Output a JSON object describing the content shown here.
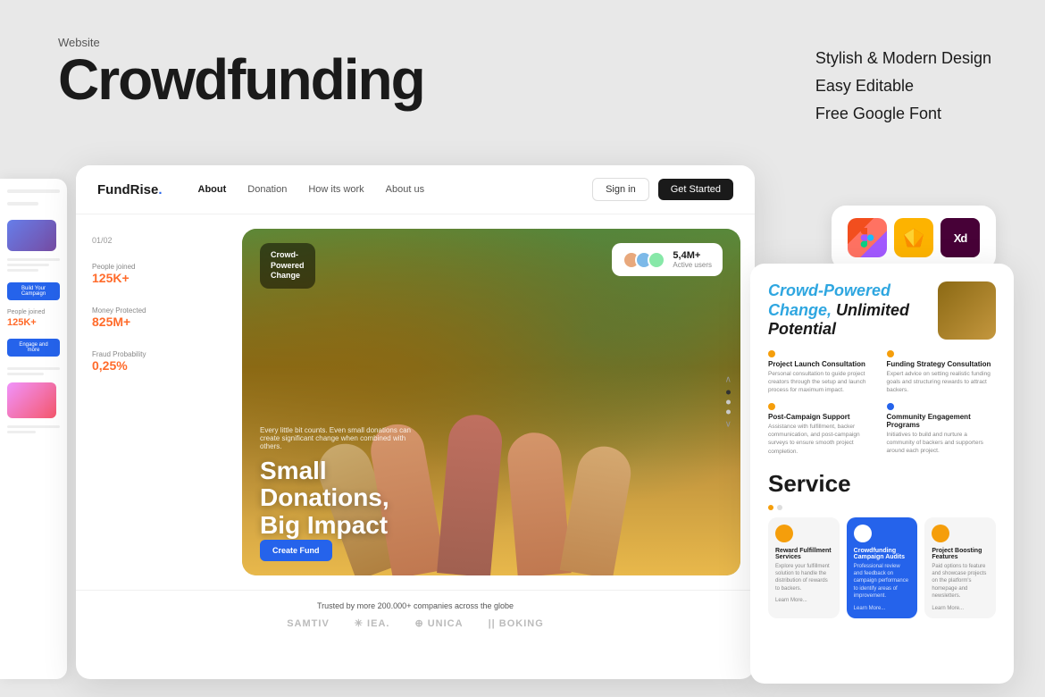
{
  "meta": {
    "website_label": "Website",
    "main_title": "Crowdfunding"
  },
  "features": {
    "item1": "Stylish & Modern Design",
    "item2": "Easy Editable",
    "item3": "Free Google Font"
  },
  "navbar": {
    "logo": "FundRise.",
    "links": [
      "About",
      "Donation",
      "How its work",
      "About us"
    ],
    "active_link": "About",
    "signin": "Sign in",
    "get_started": "Get Started"
  },
  "hero": {
    "counter": "01/02",
    "card_text": "Crowd-\nPowered\nChange",
    "active_users_count": "5,4M+",
    "active_users_label": "Active users",
    "stats": [
      {
        "label": "People joined",
        "value": "125K+"
      },
      {
        "label": "Money Protected",
        "value": "825M+"
      },
      {
        "label": "Fraud Probability",
        "value": "0,25%",
        "orange": true
      }
    ],
    "subtitle": "Every little bit counts. Even small donations can create significant change when combined with others.",
    "headline_line1": "Small",
    "headline_line2": "Donations,",
    "headline_line3": "Big Impact",
    "create_fund": "Create Fund"
  },
  "trusted": {
    "text": "Trusted by more 200.000+ companies across the globe",
    "brands": [
      "SAMTIV",
      "✳ IEA.",
      "⊕ UNICA",
      "|| BOKING"
    ]
  },
  "right_panel": {
    "title_italic": "Crowd-Powered",
    "title_normal": "Change, Unlimited Potential",
    "services": [
      {
        "dot_color": "orange",
        "title": "Project Launch Consultation",
        "desc": "Personal consultation to guide project creators through the setup and launch process for maximum impact."
      },
      {
        "dot_color": "orange",
        "title": "Funding Strategy Consultation",
        "desc": "Expert advice on setting realistic funding goals and structuring rewards to attract backers."
      },
      {
        "dot_color": "orange",
        "title": "Post-Campaign Support",
        "desc": "Assistance with fulfillment, backer communication, and post-campaign surveys to ensure smooth project completion."
      },
      {
        "dot_color": "blue",
        "title": "Community Engagement Programs",
        "desc": "Initiatives to build and nurture a community of backers and supporters around each project."
      }
    ],
    "section_title": "Service",
    "cards": [
      {
        "dot_color": "orange",
        "title": "Reward Fulfillment Services",
        "desc": "Explore your fulfillment solution to handle the distribution of rewards to backers.",
        "learn_more": "Learn More..."
      },
      {
        "dot_color": "blue",
        "style": "blue",
        "title": "Crowdfunding Campaign Audits",
        "desc": "Professional review and feedback on campaign performance to identify areas of improvement.",
        "learn_more": "Learn More..."
      },
      {
        "dot_color": "orange",
        "title": "Project Boosting Features",
        "desc": "Paid options to feature and showcase projects on the platform's homepage and newsletters.",
        "learn_more": "Learn More..."
      }
    ]
  },
  "tool_icons": {
    "figma_label": "F",
    "sketch_label": "S",
    "xd_label": "Xd"
  }
}
